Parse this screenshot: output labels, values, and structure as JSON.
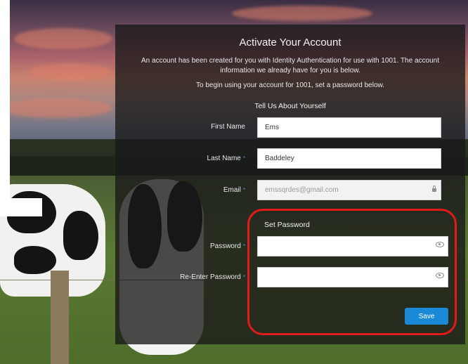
{
  "form": {
    "title": "Activate Your Account",
    "intro": "An account has been created for you with Identity Authentication for use with 1001. The account information we already have for you is below.",
    "begin_text": "To begin using your account for 1001, set a password below.",
    "about_heading": "Tell Us About Yourself",
    "fields": {
      "first_name": {
        "label": "First Name",
        "value": "Ems"
      },
      "last_name": {
        "label": "Last Name",
        "required_mark": "*",
        "value": "Baddeley"
      },
      "email": {
        "label": "Email",
        "required_mark": "*",
        "value": "emssqrdes@gmail.com"
      }
    },
    "password_heading": "Set Password",
    "password": {
      "label": "Password",
      "required_mark": "*",
      "value": ""
    },
    "reenter_password": {
      "label": "Re-Enter Password",
      "required_mark": "*",
      "value": ""
    },
    "save_label": "Save"
  },
  "icons": {
    "email_lock": "lock-icon",
    "password_eye": "eye-icon",
    "reenter_eye": "eye-icon"
  },
  "colors": {
    "highlight": "#e21a1a",
    "save_button": "#1b8ad6",
    "required_mark": "#4a8fd6"
  }
}
